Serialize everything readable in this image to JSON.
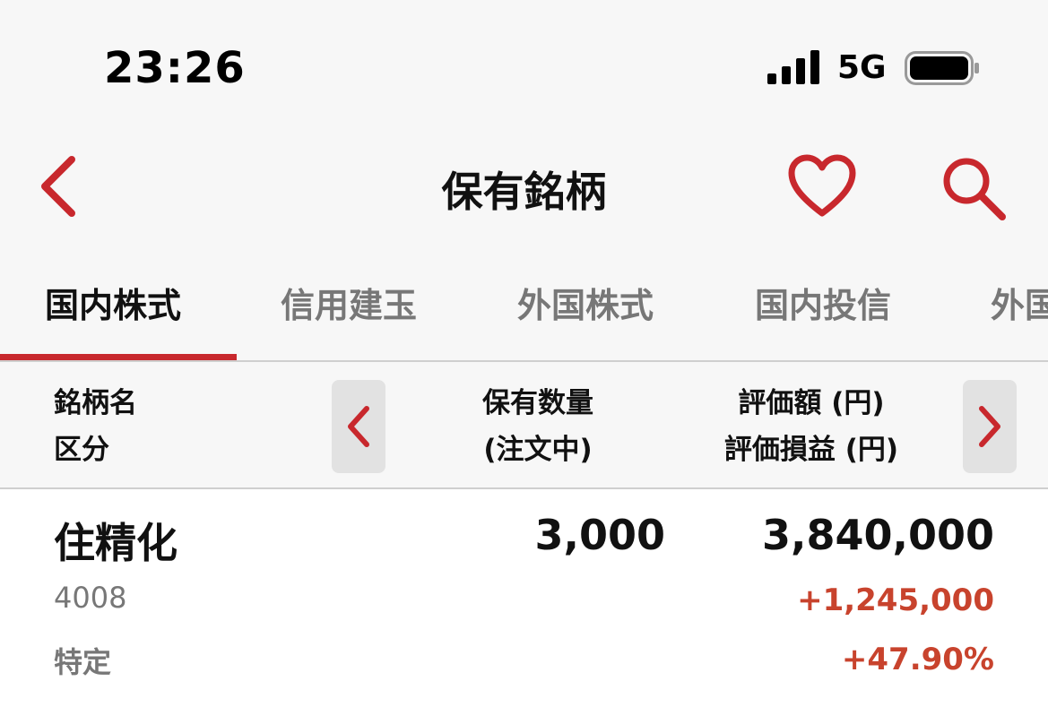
{
  "status_bar": {
    "time": "23:26",
    "network": "5G",
    "signal_icon": "signal-bars-icon",
    "battery_icon": "battery-icon"
  },
  "nav": {
    "title": "保有銘柄",
    "back_icon": "chevron-left-icon",
    "favorite_icon": "heart-icon",
    "search_icon": "search-icon"
  },
  "tabs": [
    {
      "label": "国内株式",
      "active": true
    },
    {
      "label": "信用建玉",
      "active": false
    },
    {
      "label": "外国株式",
      "active": false
    },
    {
      "label": "国内投信",
      "active": false
    },
    {
      "label": "外国",
      "active": false
    }
  ],
  "columns": {
    "name_line1": "銘柄名",
    "name_line2": "区分",
    "qty_line1": "保有数量",
    "qty_line2": "(注文中)",
    "value_line1": "評価額 (円)",
    "value_line2": "評価損益 (円)"
  },
  "holdings": [
    {
      "name": "住精化",
      "code": "4008",
      "account": "特定",
      "quantity": "3,000",
      "market_value": "3,840,000",
      "pl_amount": "+1,245,000",
      "pl_percent": "+47.90%"
    }
  ],
  "colors": {
    "accent": "#c8282d",
    "gain": "#c8432d",
    "muted": "#777777"
  }
}
